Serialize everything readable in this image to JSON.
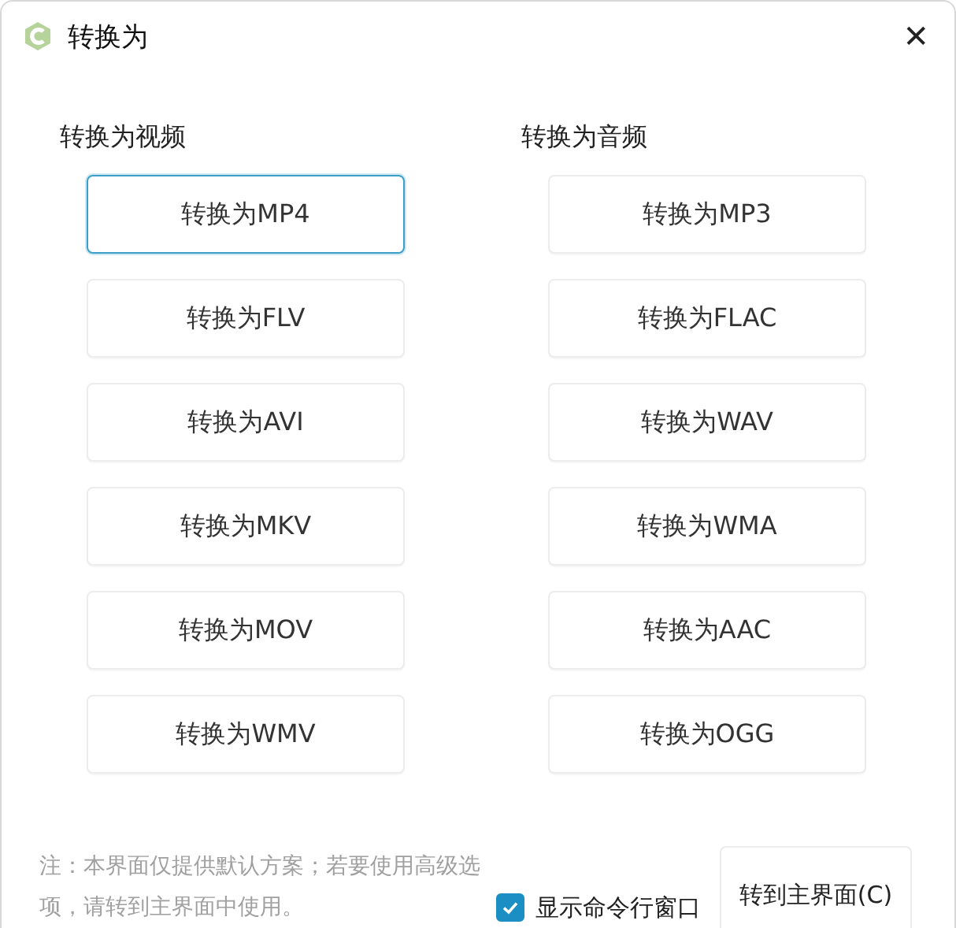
{
  "window": {
    "title": "转换为",
    "close": "✕"
  },
  "columns": [
    {
      "heading": "转换为视频",
      "buttons": [
        {
          "label": "转换为MP4",
          "focused": true
        },
        {
          "label": "转换为FLV",
          "focused": false
        },
        {
          "label": "转换为AVI",
          "focused": false
        },
        {
          "label": "转换为MKV",
          "focused": false
        },
        {
          "label": "转换为MOV",
          "focused": false
        },
        {
          "label": "转换为WMV",
          "focused": false
        }
      ]
    },
    {
      "heading": "转换为音频",
      "buttons": [
        {
          "label": "转换为MP3",
          "focused": false
        },
        {
          "label": "转换为FLAC",
          "focused": false
        },
        {
          "label": "转换为WAV",
          "focused": false
        },
        {
          "label": "转换为WMA",
          "focused": false
        },
        {
          "label": "转换为AAC",
          "focused": false
        },
        {
          "label": "转换为OGG",
          "focused": false
        }
      ]
    }
  ],
  "footer": {
    "note": "注：本界面仅提供默认方案；若要使用高级选项，请转到主界面中使用。",
    "checkbox": {
      "label": "显示命令行窗口",
      "checked": true
    },
    "button": "转到主界面(C)"
  }
}
